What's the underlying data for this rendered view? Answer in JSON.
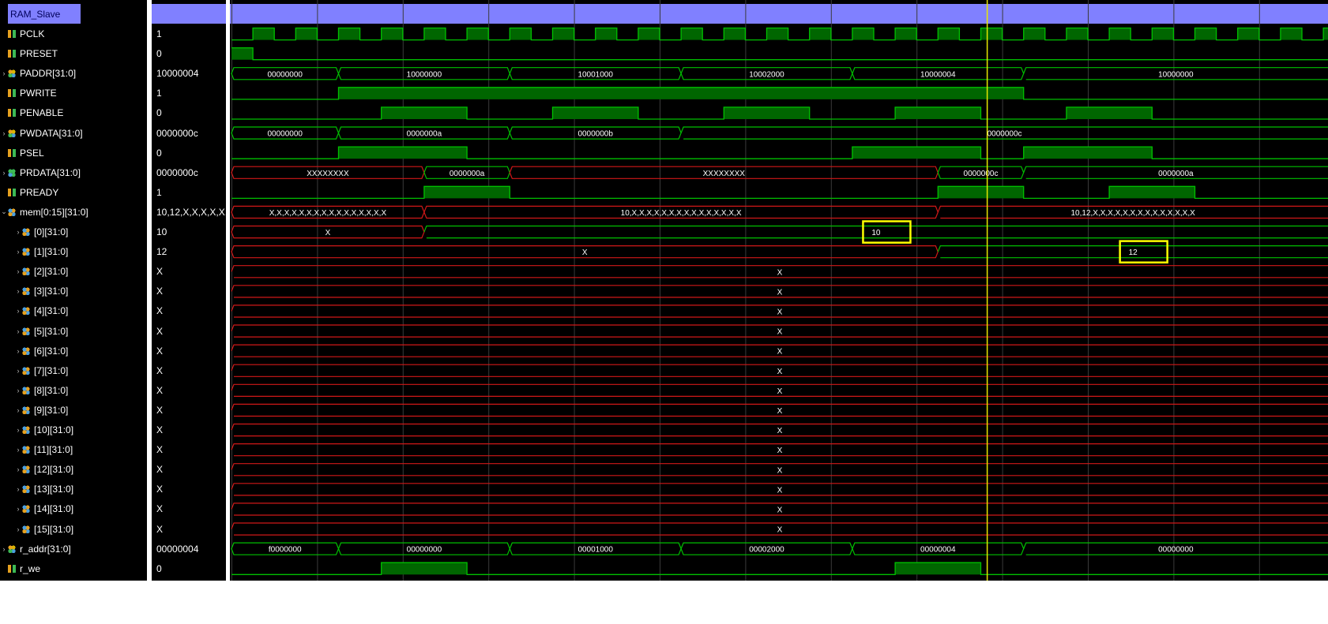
{
  "scope": {
    "group_name": "RAM_Slave"
  },
  "signals": [
    {
      "name": "PCLK",
      "value": "1",
      "icon": "scalar",
      "indent": 0,
      "expander": ""
    },
    {
      "name": "PRESET",
      "value": "0",
      "icon": "scalar",
      "indent": 0,
      "expander": ""
    },
    {
      "name": "PADDR[31:0]",
      "value": "10000004",
      "icon": "bus",
      "indent": 0,
      "expander": "›"
    },
    {
      "name": "PWRITE",
      "value": "1",
      "icon": "scalar",
      "indent": 0,
      "expander": ""
    },
    {
      "name": "PENABLE",
      "value": "0",
      "icon": "scalar",
      "indent": 0,
      "expander": ""
    },
    {
      "name": "PWDATA[31:0]",
      "value": "0000000c",
      "icon": "bus",
      "indent": 0,
      "expander": "›"
    },
    {
      "name": "PSEL",
      "value": "0",
      "icon": "scalar",
      "indent": 0,
      "expander": ""
    },
    {
      "name": "PRDATA[31:0]",
      "value": "0000000c",
      "icon": "bus-green",
      "indent": 0,
      "expander": "›"
    },
    {
      "name": "PREADY",
      "value": "1",
      "icon": "scalar",
      "indent": 0,
      "expander": ""
    },
    {
      "name": "mem[0:15][31:0]",
      "value": "10,12,X,X,X,X,X,",
      "icon": "arr",
      "indent": 0,
      "expander": "⌄"
    },
    {
      "name": "[0][31:0]",
      "value": "10",
      "icon": "arr",
      "indent": 1,
      "expander": "›"
    },
    {
      "name": "[1][31:0]",
      "value": "12",
      "icon": "arr",
      "indent": 1,
      "expander": "›"
    },
    {
      "name": "[2][31:0]",
      "value": "X",
      "icon": "arr",
      "indent": 1,
      "expander": "›"
    },
    {
      "name": "[3][31:0]",
      "value": "X",
      "icon": "arr",
      "indent": 1,
      "expander": "›"
    },
    {
      "name": "[4][31:0]",
      "value": "X",
      "icon": "arr",
      "indent": 1,
      "expander": "›"
    },
    {
      "name": "[5][31:0]",
      "value": "X",
      "icon": "arr",
      "indent": 1,
      "expander": "›"
    },
    {
      "name": "[6][31:0]",
      "value": "X",
      "icon": "arr",
      "indent": 1,
      "expander": "›"
    },
    {
      "name": "[7][31:0]",
      "value": "X",
      "icon": "arr",
      "indent": 1,
      "expander": "›"
    },
    {
      "name": "[8][31:0]",
      "value": "X",
      "icon": "arr",
      "indent": 1,
      "expander": "›"
    },
    {
      "name": "[9][31:0]",
      "value": "X",
      "icon": "arr",
      "indent": 1,
      "expander": "›"
    },
    {
      "name": "[10][31:0]",
      "value": "X",
      "icon": "arr",
      "indent": 1,
      "expander": "›"
    },
    {
      "name": "[11][31:0]",
      "value": "X",
      "icon": "arr",
      "indent": 1,
      "expander": "›"
    },
    {
      "name": "[12][31:0]",
      "value": "X",
      "icon": "arr",
      "indent": 1,
      "expander": "›"
    },
    {
      "name": "[13][31:0]",
      "value": "X",
      "icon": "arr",
      "indent": 1,
      "expander": "›"
    },
    {
      "name": "[14][31:0]",
      "value": "X",
      "icon": "arr",
      "indent": 1,
      "expander": "›"
    },
    {
      "name": "[15][31:0]",
      "value": "X",
      "icon": "arr",
      "indent": 1,
      "expander": "›"
    },
    {
      "name": "r_addr[31:0]",
      "value": "00000004",
      "icon": "bus",
      "indent": 0,
      "expander": "›"
    },
    {
      "name": "r_we",
      "value": "0",
      "icon": "scalar",
      "indent": 0,
      "expander": ""
    }
  ],
  "waves": {
    "clock_period": 2,
    "PRESET": {
      "kind": "bit",
      "edges": [
        [
          0,
          1
        ],
        [
          1,
          0
        ]
      ]
    },
    "PADDR": {
      "kind": "bus",
      "segs": [
        [
          0,
          "00000000"
        ],
        [
          5,
          "10000000"
        ],
        [
          13,
          "10001000"
        ],
        [
          21,
          "10002000"
        ],
        [
          29,
          "10000004"
        ],
        [
          37,
          "10000000"
        ]
      ]
    },
    "PWRITE": {
      "kind": "bit",
      "edges": [
        [
          0,
          0
        ],
        [
          5,
          1
        ],
        [
          37,
          0
        ]
      ]
    },
    "PENABLE": {
      "kind": "bit",
      "edges": [
        [
          0,
          0
        ],
        [
          7,
          1
        ],
        [
          11,
          0
        ],
        [
          15,
          1
        ],
        [
          19,
          0
        ],
        [
          23,
          1
        ],
        [
          27,
          0
        ],
        [
          31,
          1
        ],
        [
          35,
          0
        ],
        [
          39,
          1
        ],
        [
          43,
          0
        ]
      ]
    },
    "PWDATA": {
      "kind": "bus",
      "segs": [
        [
          0,
          "00000000"
        ],
        [
          5,
          "0000000a"
        ],
        [
          13,
          "0000000b"
        ],
        [
          21,
          "0000000c"
        ]
      ]
    },
    "PSEL": {
      "kind": "bit",
      "edges": [
        [
          0,
          0
        ],
        [
          5,
          1
        ],
        [
          11,
          0
        ],
        [
          29,
          1
        ],
        [
          35,
          0
        ],
        [
          37,
          1
        ],
        [
          43,
          0
        ]
      ]
    },
    "PRDATA": {
      "kind": "bus",
      "segs": [
        [
          0,
          "XXXXXXXX",
          "x"
        ],
        [
          9,
          "0000000a"
        ],
        [
          13,
          "XXXXXXXX",
          "x"
        ],
        [
          33,
          "0000000c"
        ],
        [
          37,
          "0000000a"
        ]
      ]
    },
    "PREADY": {
      "kind": "bit",
      "edges": [
        [
          0,
          0
        ],
        [
          9,
          1
        ],
        [
          13,
          0
        ],
        [
          33,
          1
        ],
        [
          37,
          0
        ],
        [
          41,
          1
        ],
        [
          45,
          0
        ]
      ]
    },
    "mem": {
      "kind": "bus",
      "segs": [
        [
          0,
          "X,X,X,X,X,X,X,X,X,X,X,X,X,X,X,X",
          "x"
        ],
        [
          9,
          "10,X,X,X,X,X,X,X,X,X,X,X,X,X,X,X",
          "x"
        ],
        [
          33,
          "10,12,X,X,X,X,X,X,X,X,X,X,X,X,X,X",
          "x"
        ]
      ]
    },
    "mem0": {
      "kind": "bus",
      "segs": [
        [
          0,
          "X",
          "x"
        ],
        [
          9,
          "10"
        ]
      ]
    },
    "mem1": {
      "kind": "bus",
      "segs": [
        [
          0,
          "X",
          "x"
        ],
        [
          33,
          "12"
        ]
      ]
    },
    "memX": {
      "kind": "bus",
      "segs": [
        [
          0,
          "X",
          "x"
        ]
      ]
    },
    "r_addr": {
      "kind": "bus",
      "segs": [
        [
          0,
          "f0000000"
        ],
        [
          5,
          "00000000"
        ],
        [
          13,
          "00001000"
        ],
        [
          21,
          "00002000"
        ],
        [
          29,
          "00000004"
        ],
        [
          37,
          "00000000"
        ]
      ]
    },
    "r_we": {
      "kind": "bit",
      "edges": [
        [
          0,
          0
        ],
        [
          7,
          1
        ],
        [
          11,
          0
        ],
        [
          31,
          1
        ],
        [
          35,
          0
        ]
      ]
    }
  },
  "highlights": [
    {
      "row": 10,
      "time": 29.5,
      "label": "10"
    },
    {
      "row": 11,
      "time": 41.5,
      "label": "12"
    }
  ],
  "cursor": {
    "time": 35.3
  },
  "colors": {
    "wave_green": "#00c000",
    "wave_fill": "#006600",
    "xstate_red": "#d01818",
    "grid": "#3a3a3a",
    "cursor": "#e8e800",
    "highlight": "#ffff00",
    "group_header": "#8080ff"
  }
}
